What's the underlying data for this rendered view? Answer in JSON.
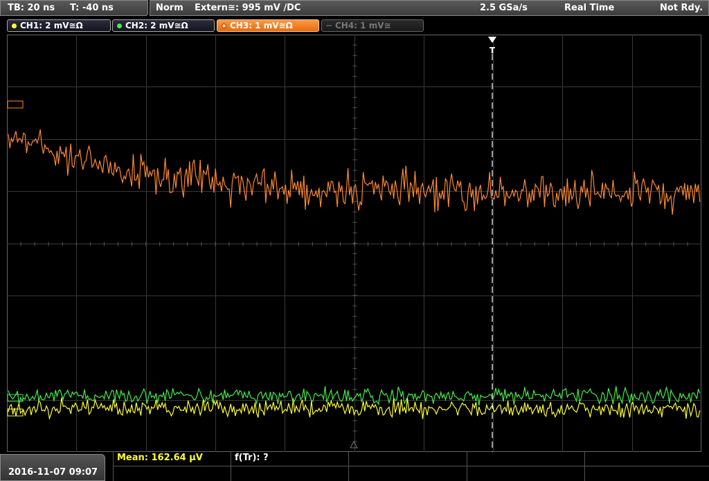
{
  "topbar": {
    "timebase": "TB: 20 ns",
    "trigger_time": "T: -40 ns",
    "mode": "Norm",
    "trigger_source": "Extern≅: 995 mV ∕DC",
    "sample_rate": "2.5 GSa/s",
    "acq_mode": "Real Time",
    "status": "Not Rdy."
  },
  "channels": [
    {
      "label": "CH1: 2 mV≅Ω",
      "color": "#ffff33",
      "state": "on"
    },
    {
      "label": "CH2: 2 mV≅Ω",
      "color": "#44ee44",
      "state": "on"
    },
    {
      "label": "CH3: 1 mV≅Ω",
      "color": "#ff8a30",
      "state": "active"
    },
    {
      "label": "CH4: 1 mV≅",
      "color": "#777777",
      "state": "off"
    }
  ],
  "trigger_marker": "T",
  "footer": {
    "datetime": "2016-11-07 09:07",
    "mean": "Mean: 162.64 µV",
    "freq": "f(Tr): ?"
  },
  "colors": {
    "ch1": "#ffff33",
    "ch2": "#44ee44",
    "ch3": "#ff8a30",
    "grid": "#3a3a3a"
  }
}
